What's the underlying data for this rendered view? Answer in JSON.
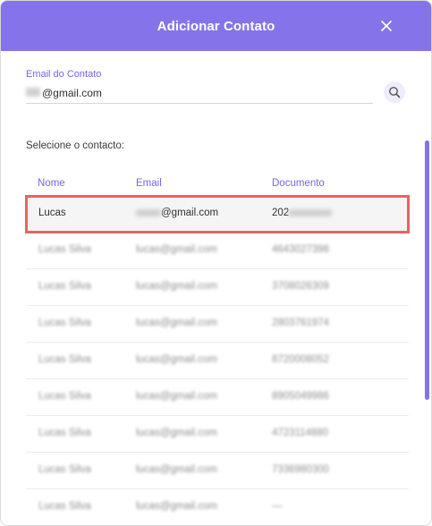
{
  "dialog": {
    "title": "Adicionar Contato",
    "close_icon": "close-icon"
  },
  "search": {
    "label": "Email do Contato",
    "value_suffix": "@gmail.com",
    "search_icon": "search-icon"
  },
  "table": {
    "select_label": "Selecione o contacto:",
    "headers": {
      "name": "Nome",
      "email": "Email",
      "document": "Documento"
    },
    "selected_row": {
      "name": "Lucas",
      "email_suffix": "@gmail.com",
      "document_prefix": "202"
    },
    "rows": [
      {
        "name": "Lucas Silva",
        "email": "lucas@gmail.com",
        "document": "4643027398"
      },
      {
        "name": "Lucas Silva",
        "email": "lucas@gmail.com",
        "document": "3708026309"
      },
      {
        "name": "Lucas Silva",
        "email": "lucas@gmail.com",
        "document": "2803761974"
      },
      {
        "name": "Lucas Silva",
        "email": "lucas@gmail.com",
        "document": "8720008052"
      },
      {
        "name": "Lucas Silva",
        "email": "lucas@gmail.com",
        "document": "8905049986"
      },
      {
        "name": "Lucas Silva",
        "email": "lucas@gmail.com",
        "document": "4723114880"
      },
      {
        "name": "Lucas Silva",
        "email": "lucas@gmail.com",
        "document": "7336980300"
      },
      {
        "name": "Lucas Silva",
        "email": "lucas@gmail.com",
        "document": "—"
      }
    ]
  },
  "colors": {
    "header": "#8573e9",
    "accent_text": "#7b63e6",
    "selection_outline": "#e56464"
  }
}
